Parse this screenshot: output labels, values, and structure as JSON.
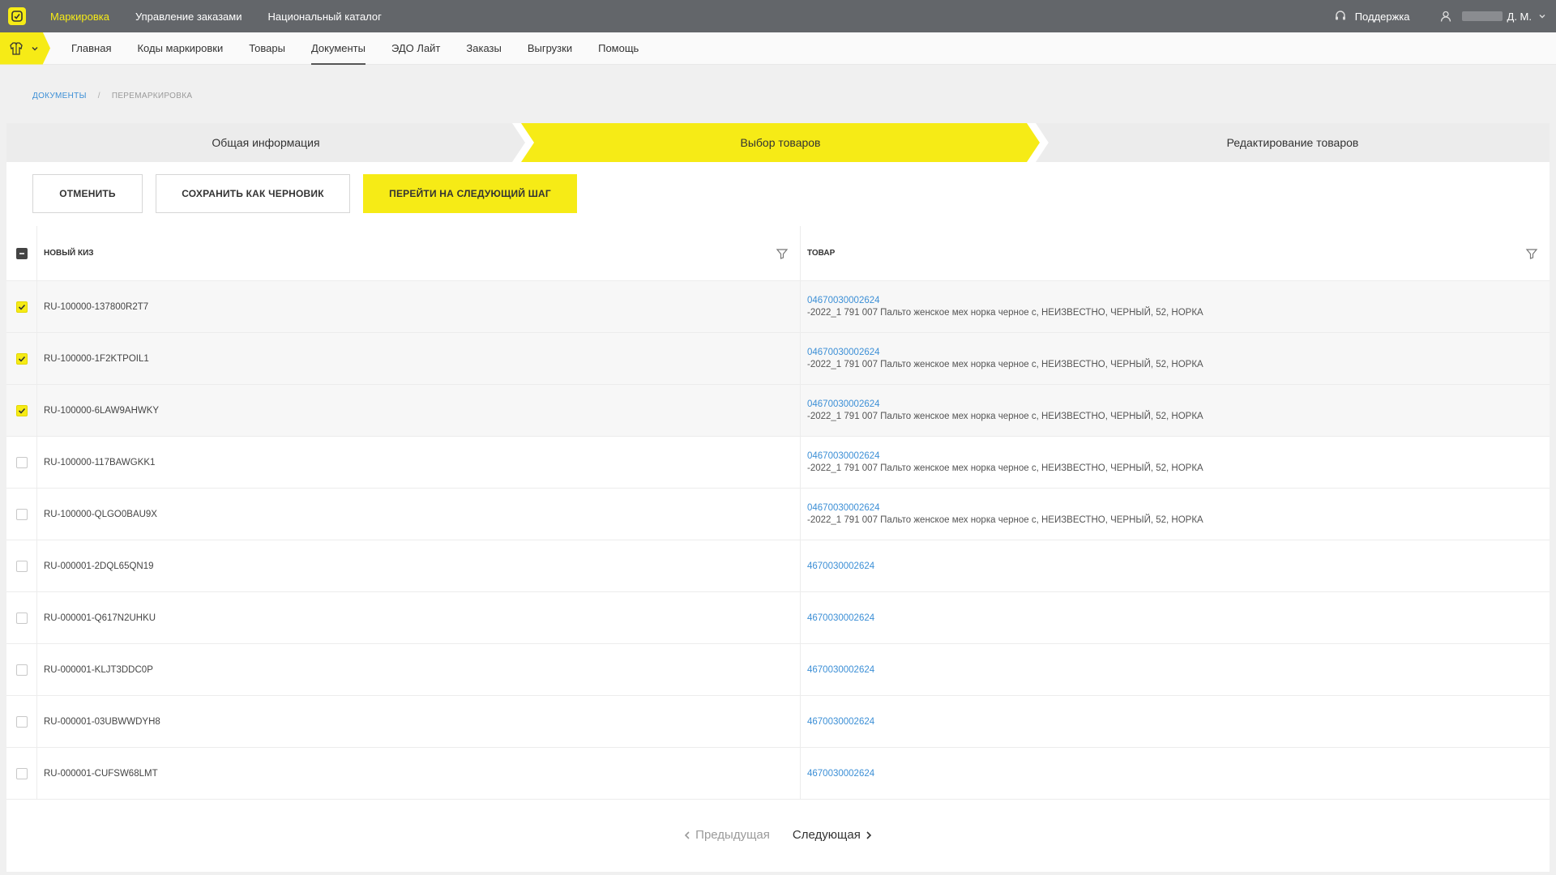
{
  "topnav": {
    "items": [
      "Маркировка",
      "Управление заказами",
      "Национальный каталог"
    ],
    "support": "Поддержка",
    "user": "Д. М."
  },
  "subnav": {
    "items": [
      "Главная",
      "Коды маркировки",
      "Товары",
      "Документы",
      "ЭДО Лайт",
      "Заказы",
      "Выгрузки",
      "Помощь"
    ]
  },
  "breadcrumb": {
    "parent": "ДОКУМЕНТЫ",
    "separator": "/",
    "current": "ПЕРЕМАРКИРОВКА"
  },
  "stepper": {
    "steps": [
      "Общая информация",
      "Выбор товаров",
      "Редактирование товаров"
    ]
  },
  "actions": {
    "cancel": "ОТМЕНИТЬ",
    "draft": "СОХРАНИТЬ КАК ЧЕРНОВИК",
    "next": "ПЕРЕЙТИ НА СЛЕДУЮЩИЙ ШАГ"
  },
  "table": {
    "columns": [
      "НОВЫЙ КИЗ",
      "ТОВАР"
    ],
    "rows": [
      {
        "kiz": "RU-100000-137800R2T7",
        "gtin": "04670030002624",
        "desc": "-2022_1 791 007 Пальто женское мех норка черное с, НЕИЗВЕСТНО, ЧЕРНЫЙ, 52, НОРКА"
      },
      {
        "kiz": "RU-100000-1F2KTPOIL1",
        "gtin": "04670030002624",
        "desc": "-2022_1 791 007 Пальто женское мех норка черное с, НЕИЗВЕСТНО, ЧЕРНЫЙ, 52, НОРКА"
      },
      {
        "kiz": "RU-100000-6LAW9AHWKY",
        "gtin": "04670030002624",
        "desc": "-2022_1 791 007 Пальто женское мех норка черное с, НЕИЗВЕСТНО, ЧЕРНЫЙ, 52, НОРКА"
      },
      {
        "kiz": "RU-100000-117BAWGKK1",
        "gtin": "04670030002624",
        "desc": "-2022_1 791 007 Пальто женское мех норка черное с, НЕИЗВЕСТНО, ЧЕРНЫЙ, 52, НОРКА"
      },
      {
        "kiz": "RU-100000-QLGO0BAU9X",
        "gtin": "04670030002624",
        "desc": "-2022_1 791 007 Пальто женское мех норка черное с, НЕИЗВЕСТНО, ЧЕРНЫЙ, 52, НОРКА"
      },
      {
        "kiz": "RU-000001-2DQL65QN19",
        "gtin": "4670030002624",
        "desc": ""
      },
      {
        "kiz": "RU-000001-Q617N2UHKU",
        "gtin": "4670030002624",
        "desc": ""
      },
      {
        "kiz": "RU-000001-KLJT3DDC0P",
        "gtin": "4670030002624",
        "desc": ""
      },
      {
        "kiz": "RU-000001-03UBWWDYH8",
        "gtin": "4670030002624",
        "desc": ""
      },
      {
        "kiz": "RU-000001-CUFSW68LMT",
        "gtin": "4670030002624",
        "desc": ""
      }
    ]
  },
  "pagination": {
    "prev": "Предыдущая",
    "next": "Следующая"
  },
  "colors": {
    "accent": "#f6eb16",
    "topbar": "#63666a",
    "link": "#3c8fd6"
  }
}
